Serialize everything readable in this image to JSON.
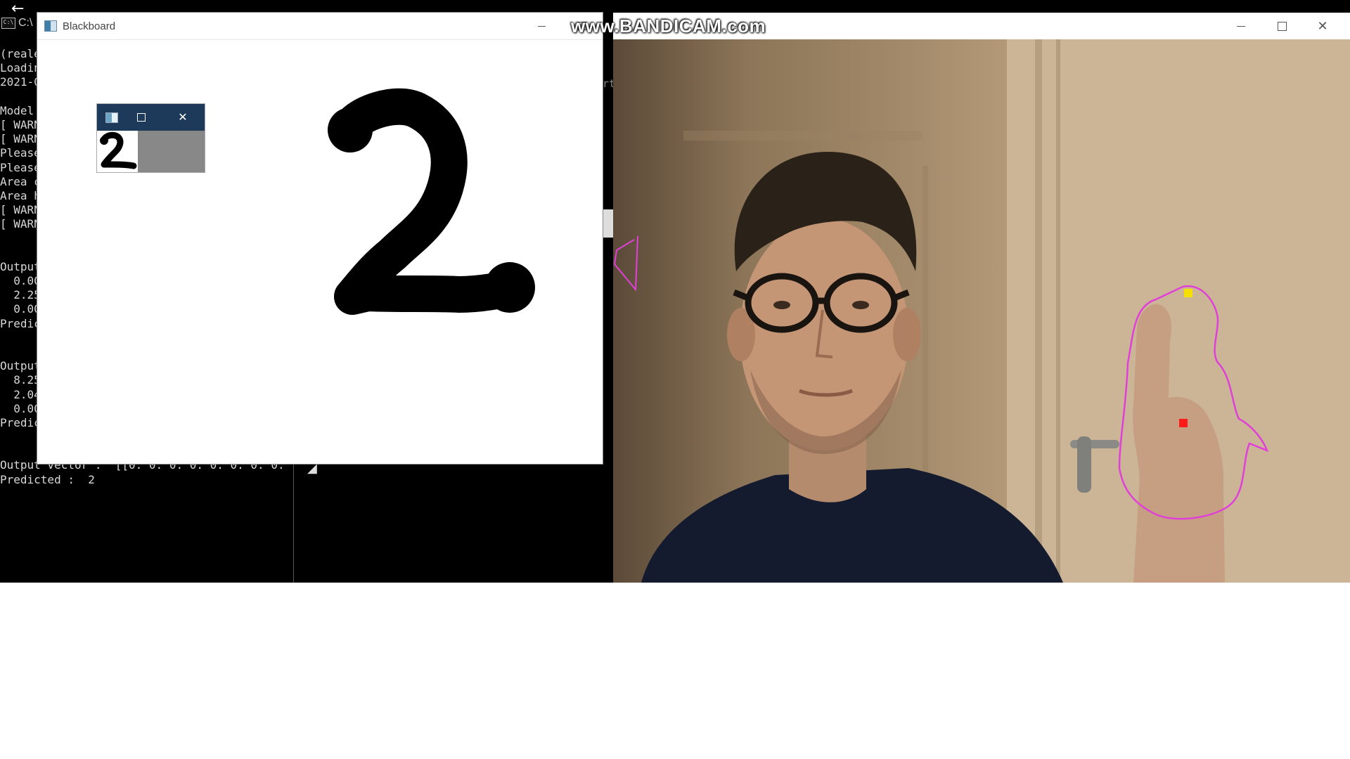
{
  "watermark": "www.BANDICAM.com",
  "console": {
    "title_fragment": "C:\\",
    "lines": [
      "(reale",
      "Loadin",
      "2021-0",
      "",
      "Model ",
      "[ WARN",
      "[ WARN",
      "Please",
      "Please",
      "Area c",
      "Area h",
      "[ WARN",
      "[ WARN",
      "",
      "",
      "Output",
      "  0.00",
      "  2.25",
      "  0.00",
      "Predic",
      "",
      "",
      "Output",
      "  8.25",
      "  2.04",
      "  0.00",
      "Predic",
      "",
      "",
      "Output vector :  [[0. 0. 0. 0. 0. 0. 0. 0.",
      "Predicted :  2"
    ],
    "side_fragment": "rt"
  },
  "blackboard": {
    "title": "Blackboard",
    "drawn_digit": "2"
  },
  "preview_window": {
    "digit": "2"
  },
  "camera_window": {
    "markers": {
      "fingertip_color": "#f5e000",
      "centroid_color": "#ff1a1a",
      "contour_color": "#e040d8"
    }
  }
}
